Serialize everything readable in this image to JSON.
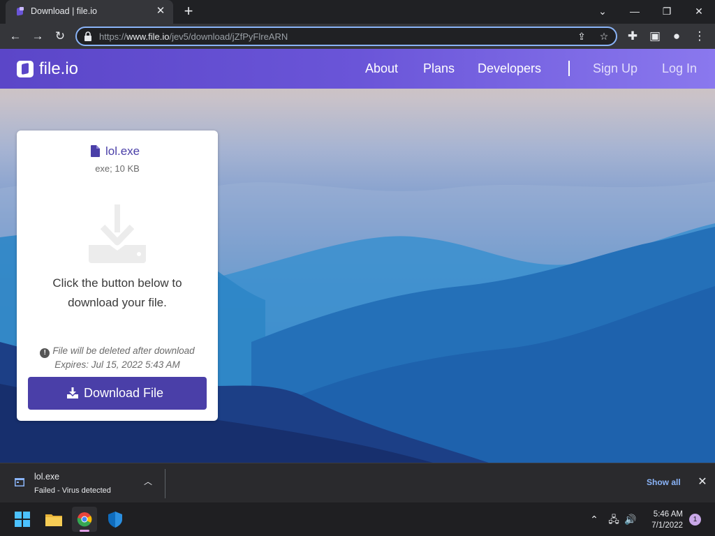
{
  "browser": {
    "tab_title": "Download | file.io",
    "url_prefix": "https://",
    "url_host": "www.file.io",
    "url_path": "/jev5/download/jZfPyFlreARN"
  },
  "nav": {
    "logo_text": "file.io",
    "links": [
      "About",
      "Plans",
      "Developers"
    ],
    "sign_up": "Sign Up",
    "log_in": "Log In"
  },
  "card": {
    "file_name": "lol.exe",
    "file_meta": "exe; 10 KB",
    "instruction": "Click the button below to download your file.",
    "warning": "File will be deleted after download",
    "expires": "Expires: Jul 15, 2022 5:43 AM",
    "button_label": "Download File"
  },
  "download_shelf": {
    "file_name": "lol.exe",
    "status": "Failed - Virus detected",
    "show_all": "Show all"
  },
  "taskbar": {
    "time": "5:46 AM",
    "date": "7/1/2022",
    "notification_count": "1"
  },
  "colors": {
    "brand": "#5b46c8",
    "button": "#4a3fa8",
    "link_blue": "#8ab4f8"
  }
}
